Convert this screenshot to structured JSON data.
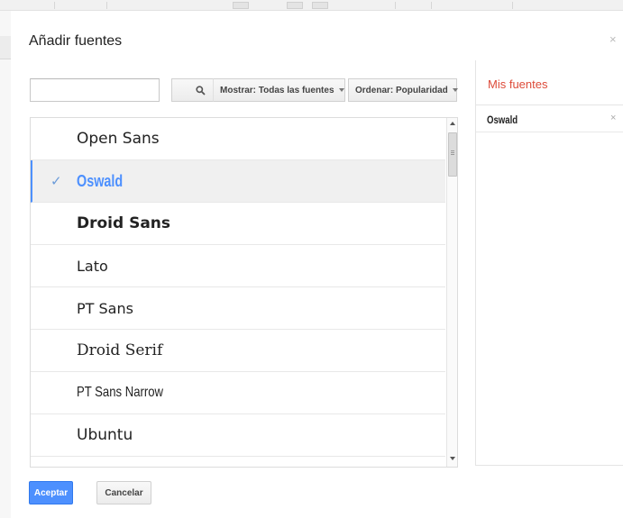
{
  "dialog": {
    "title": "Añadir fuentes",
    "close_glyph": "×"
  },
  "search": {
    "value": "",
    "placeholder": "",
    "icon": "magnifier-icon"
  },
  "filters": {
    "show_label": "Mostrar: Todas las fuentes",
    "sort_label": "Ordenar: Popularidad"
  },
  "font_list": {
    "selected_index": 1,
    "items": [
      {
        "name": "Open Sans",
        "selected": false
      },
      {
        "name": "Oswald",
        "selected": true
      },
      {
        "name": "Droid Sans",
        "selected": false
      },
      {
        "name": "Lato",
        "selected": false
      },
      {
        "name": "PT Sans",
        "selected": false
      },
      {
        "name": "Droid Serif",
        "selected": false
      },
      {
        "name": "PT Sans Narrow",
        "selected": false
      },
      {
        "name": "Ubuntu",
        "selected": false
      }
    ],
    "check_glyph": "✓"
  },
  "my_fonts": {
    "title": "Mis fuentes",
    "items": [
      {
        "name": "Oswald",
        "remove_glyph": "×"
      }
    ]
  },
  "footer": {
    "accept_label": "Aceptar",
    "cancel_label": "Cancelar"
  },
  "colors": {
    "accent": "#4d90fe",
    "panel_title": "#dd4b39"
  }
}
